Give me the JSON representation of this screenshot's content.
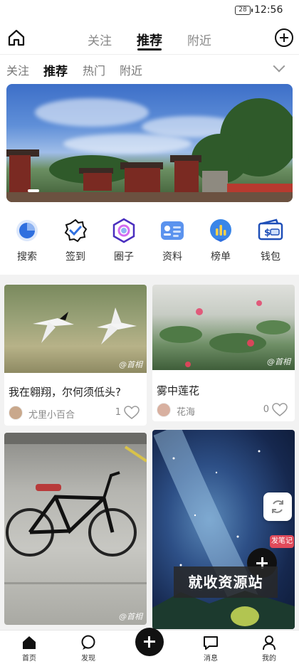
{
  "status_bar": {
    "battery": "28",
    "time": "12:56"
  },
  "header": {
    "tabs": [
      {
        "label": "关注"
      },
      {
        "label": "推荐"
      },
      {
        "label": "附近"
      }
    ]
  },
  "subtabs": [
    {
      "label": "关注"
    },
    {
      "label": "推荐"
    },
    {
      "label": "热门"
    },
    {
      "label": "附近"
    }
  ],
  "shortcuts": [
    {
      "label": "搜索",
      "icon": "search-icon"
    },
    {
      "label": "签到",
      "icon": "checkin-icon"
    },
    {
      "label": "圈子",
      "icon": "circle-icon"
    },
    {
      "label": "资料",
      "icon": "profile-card-icon"
    },
    {
      "label": "榜单",
      "icon": "ranking-icon"
    },
    {
      "label": "钱包",
      "icon": "wallet-icon"
    }
  ],
  "feed": [
    {
      "title": "我在翱翔，尔何须低头?",
      "author": "尤里小百合",
      "likes": "1",
      "watermark": "@首相"
    },
    {
      "title": "雾中莲花",
      "author": "花海",
      "likes": "0",
      "watermark": "@首相"
    },
    {
      "watermark": "@首相"
    },
    {}
  ],
  "overlays": {
    "post_badge": "发笔记",
    "promo_text": "就收资源站"
  },
  "bottom_nav": [
    {
      "label": "首页",
      "icon": "home-icon"
    },
    {
      "label": "发现",
      "icon": "discover-icon"
    },
    {
      "label": "",
      "icon": "add-icon"
    },
    {
      "label": "消息",
      "icon": "message-icon"
    },
    {
      "label": "我的",
      "icon": "user-icon"
    }
  ],
  "colors": {
    "accent_blue": "#2f6fdf",
    "badge_red": "#e04a5a",
    "text_dark": "#111111"
  }
}
